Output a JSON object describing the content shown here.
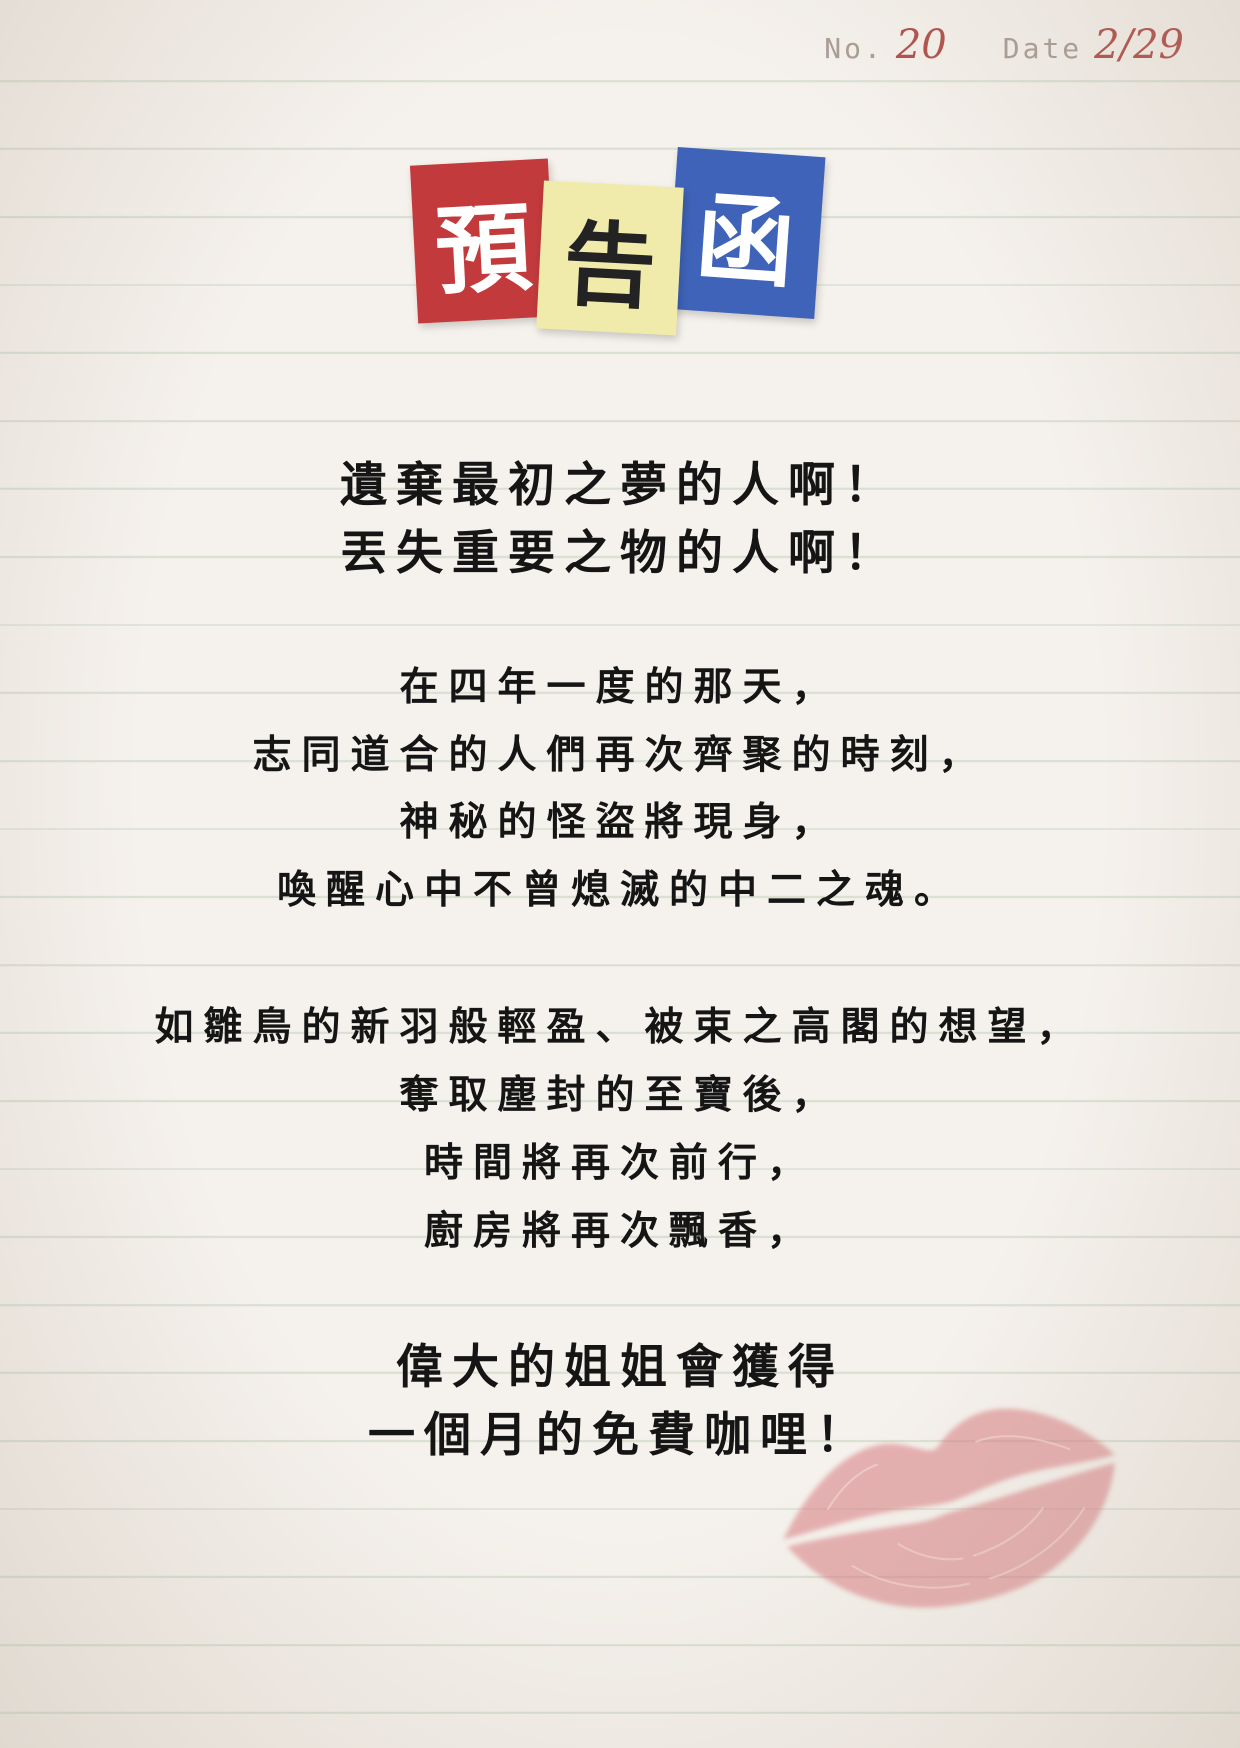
{
  "header": {
    "no_label": "No.",
    "no_value": "20",
    "date_label": "Date",
    "date_value": "2/29"
  },
  "logo": {
    "chars": [
      "預",
      "告",
      "函"
    ],
    "colors": [
      "#c23a3c",
      "#f0ebaa",
      "#3f63b8"
    ]
  },
  "letter": {
    "stanza1": [
      "遺棄最初之夢的人啊！",
      "丟失重要之物的人啊！"
    ],
    "stanza2": [
      "在四年一度的那天，",
      "志同道合的人們再次齊聚的時刻，",
      "神秘的怪盜將現身，",
      "喚醒心中不曾熄滅的中二之魂。"
    ],
    "stanza3": [
      "如雛鳥的新羽般輕盈、被束之高閣的想望，",
      "奪取塵封的至寶後，",
      "時間將再次前行，",
      "廚房將再次飄香，"
    ],
    "stanza4": [
      "偉大的姐姐會獲得",
      "一個月的免費咖哩！"
    ]
  },
  "decor": {
    "kiss_mark": "lips-icon",
    "kiss_color": "#d97a80"
  }
}
